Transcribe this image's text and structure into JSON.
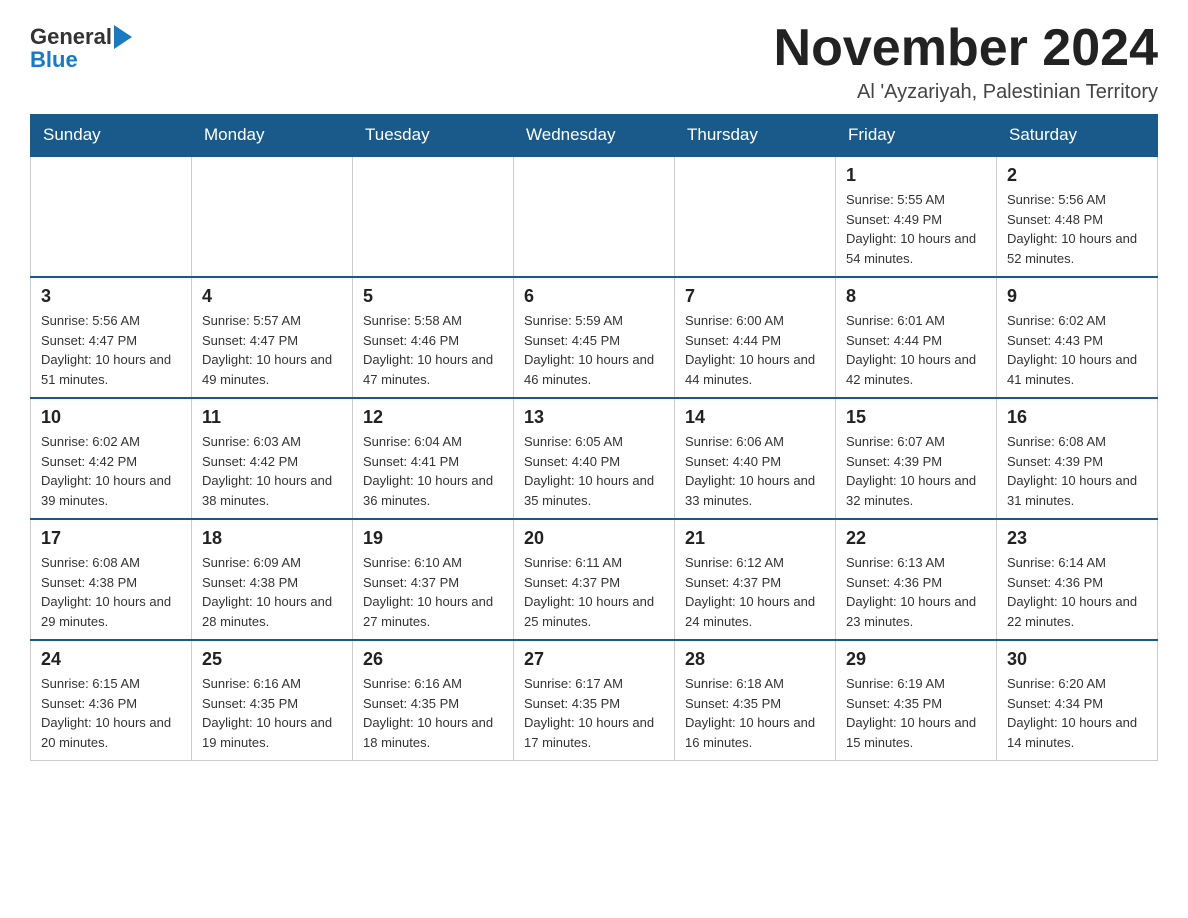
{
  "header": {
    "logo_general": "General",
    "logo_blue": "Blue",
    "title": "November 2024",
    "subtitle": "Al 'Ayzariyah, Palestinian Territory"
  },
  "calendar": {
    "days_of_week": [
      "Sunday",
      "Monday",
      "Tuesday",
      "Wednesday",
      "Thursday",
      "Friday",
      "Saturday"
    ],
    "weeks": [
      [
        {
          "day": "",
          "info": ""
        },
        {
          "day": "",
          "info": ""
        },
        {
          "day": "",
          "info": ""
        },
        {
          "day": "",
          "info": ""
        },
        {
          "day": "",
          "info": ""
        },
        {
          "day": "1",
          "info": "Sunrise: 5:55 AM\nSunset: 4:49 PM\nDaylight: 10 hours and 54 minutes."
        },
        {
          "day": "2",
          "info": "Sunrise: 5:56 AM\nSunset: 4:48 PM\nDaylight: 10 hours and 52 minutes."
        }
      ],
      [
        {
          "day": "3",
          "info": "Sunrise: 5:56 AM\nSunset: 4:47 PM\nDaylight: 10 hours and 51 minutes."
        },
        {
          "day": "4",
          "info": "Sunrise: 5:57 AM\nSunset: 4:47 PM\nDaylight: 10 hours and 49 minutes."
        },
        {
          "day": "5",
          "info": "Sunrise: 5:58 AM\nSunset: 4:46 PM\nDaylight: 10 hours and 47 minutes."
        },
        {
          "day": "6",
          "info": "Sunrise: 5:59 AM\nSunset: 4:45 PM\nDaylight: 10 hours and 46 minutes."
        },
        {
          "day": "7",
          "info": "Sunrise: 6:00 AM\nSunset: 4:44 PM\nDaylight: 10 hours and 44 minutes."
        },
        {
          "day": "8",
          "info": "Sunrise: 6:01 AM\nSunset: 4:44 PM\nDaylight: 10 hours and 42 minutes."
        },
        {
          "day": "9",
          "info": "Sunrise: 6:02 AM\nSunset: 4:43 PM\nDaylight: 10 hours and 41 minutes."
        }
      ],
      [
        {
          "day": "10",
          "info": "Sunrise: 6:02 AM\nSunset: 4:42 PM\nDaylight: 10 hours and 39 minutes."
        },
        {
          "day": "11",
          "info": "Sunrise: 6:03 AM\nSunset: 4:42 PM\nDaylight: 10 hours and 38 minutes."
        },
        {
          "day": "12",
          "info": "Sunrise: 6:04 AM\nSunset: 4:41 PM\nDaylight: 10 hours and 36 minutes."
        },
        {
          "day": "13",
          "info": "Sunrise: 6:05 AM\nSunset: 4:40 PM\nDaylight: 10 hours and 35 minutes."
        },
        {
          "day": "14",
          "info": "Sunrise: 6:06 AM\nSunset: 4:40 PM\nDaylight: 10 hours and 33 minutes."
        },
        {
          "day": "15",
          "info": "Sunrise: 6:07 AM\nSunset: 4:39 PM\nDaylight: 10 hours and 32 minutes."
        },
        {
          "day": "16",
          "info": "Sunrise: 6:08 AM\nSunset: 4:39 PM\nDaylight: 10 hours and 31 minutes."
        }
      ],
      [
        {
          "day": "17",
          "info": "Sunrise: 6:08 AM\nSunset: 4:38 PM\nDaylight: 10 hours and 29 minutes."
        },
        {
          "day": "18",
          "info": "Sunrise: 6:09 AM\nSunset: 4:38 PM\nDaylight: 10 hours and 28 minutes."
        },
        {
          "day": "19",
          "info": "Sunrise: 6:10 AM\nSunset: 4:37 PM\nDaylight: 10 hours and 27 minutes."
        },
        {
          "day": "20",
          "info": "Sunrise: 6:11 AM\nSunset: 4:37 PM\nDaylight: 10 hours and 25 minutes."
        },
        {
          "day": "21",
          "info": "Sunrise: 6:12 AM\nSunset: 4:37 PM\nDaylight: 10 hours and 24 minutes."
        },
        {
          "day": "22",
          "info": "Sunrise: 6:13 AM\nSunset: 4:36 PM\nDaylight: 10 hours and 23 minutes."
        },
        {
          "day": "23",
          "info": "Sunrise: 6:14 AM\nSunset: 4:36 PM\nDaylight: 10 hours and 22 minutes."
        }
      ],
      [
        {
          "day": "24",
          "info": "Sunrise: 6:15 AM\nSunset: 4:36 PM\nDaylight: 10 hours and 20 minutes."
        },
        {
          "day": "25",
          "info": "Sunrise: 6:16 AM\nSunset: 4:35 PM\nDaylight: 10 hours and 19 minutes."
        },
        {
          "day": "26",
          "info": "Sunrise: 6:16 AM\nSunset: 4:35 PM\nDaylight: 10 hours and 18 minutes."
        },
        {
          "day": "27",
          "info": "Sunrise: 6:17 AM\nSunset: 4:35 PM\nDaylight: 10 hours and 17 minutes."
        },
        {
          "day": "28",
          "info": "Sunrise: 6:18 AM\nSunset: 4:35 PM\nDaylight: 10 hours and 16 minutes."
        },
        {
          "day": "29",
          "info": "Sunrise: 6:19 AM\nSunset: 4:35 PM\nDaylight: 10 hours and 15 minutes."
        },
        {
          "day": "30",
          "info": "Sunrise: 6:20 AM\nSunset: 4:34 PM\nDaylight: 10 hours and 14 minutes."
        }
      ]
    ]
  }
}
